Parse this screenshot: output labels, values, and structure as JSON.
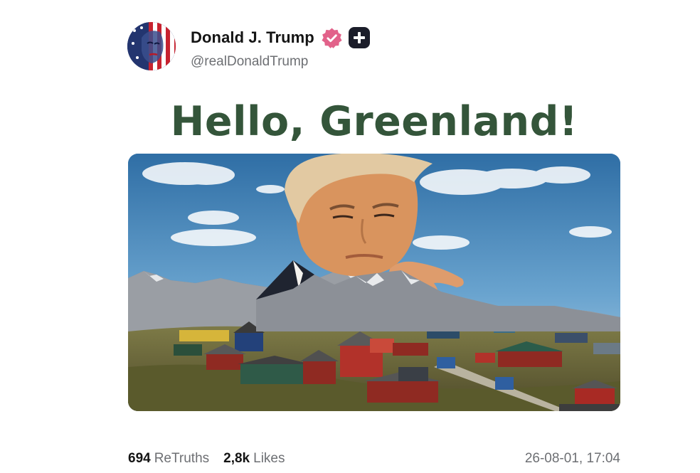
{
  "author": {
    "display_name": "Donald J. Trump",
    "handle": "@realDonaldTrump",
    "badges": [
      "verified-badge-icon",
      "plus-badge-icon"
    ]
  },
  "post": {
    "headline": "Hello, Greenland!",
    "image": {
      "icon": "photo",
      "description_colors": {
        "sky": "#4f8fbe",
        "mountains": "#8d8f95",
        "grass": "#7b7a3a"
      }
    }
  },
  "stats": {
    "retruths_count": "694",
    "retruths_label": "ReTruths",
    "likes_count": "2,8k",
    "likes_label": "Likes",
    "timestamp": "26-08-01, 17:04"
  },
  "colors": {
    "headline": "#34553a",
    "verified_badge": "#e2628a",
    "plus_badge": "#1b1d2a",
    "secondary_text": "#6d6f73"
  }
}
